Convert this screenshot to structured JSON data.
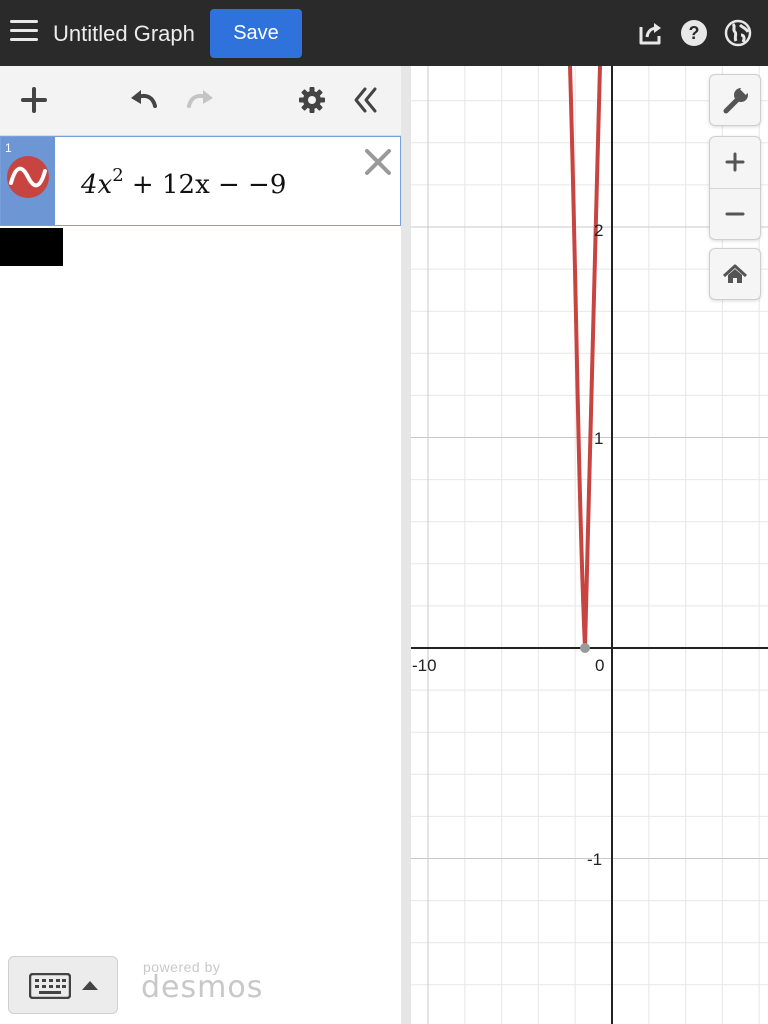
{
  "header": {
    "title": "Untitled Graph",
    "save_label": "Save",
    "icons": [
      "menu-icon",
      "share-icon",
      "help-icon",
      "globe-icon"
    ]
  },
  "toolbar": {
    "icons": [
      "add-icon",
      "undo-icon",
      "redo-icon",
      "settings-icon",
      "collapse-icon"
    ]
  },
  "expressions": [
    {
      "number": "1",
      "text_main": "4x",
      "text_exp": "2",
      "text_rest": " + 12x − −9",
      "color": "#c74440"
    }
  ],
  "footer": {
    "powered_by": "powered by",
    "brand": "desmos"
  },
  "graph": {
    "axis_labels": {
      "x_neg": "-10",
      "origin": "0",
      "y_2": "2",
      "y_1": "1",
      "y_neg1": "-1"
    },
    "curve_color": "#c74440",
    "buttons": [
      "wrench-icon",
      "zoom-in-icon",
      "zoom-out-icon",
      "home-icon"
    ]
  }
}
